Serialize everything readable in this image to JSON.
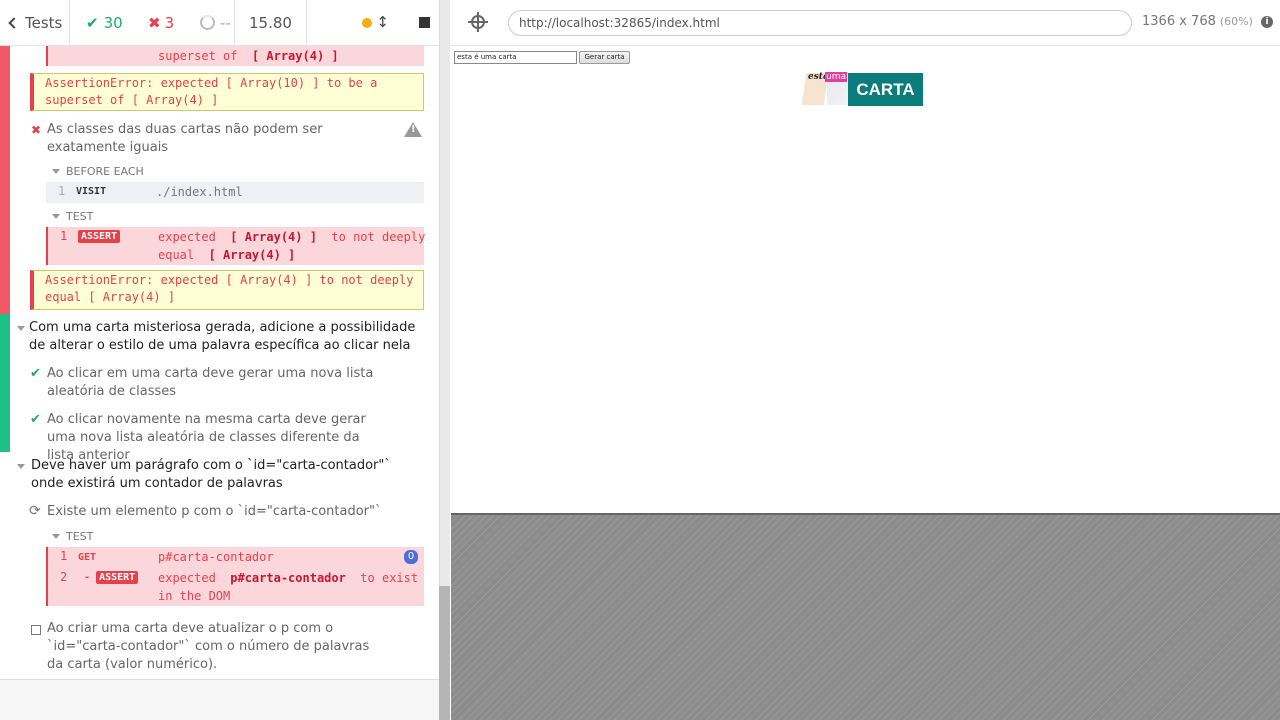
{
  "stats": {
    "tests_label": "Tests",
    "passed": "30",
    "failed": "3",
    "pending": "--",
    "duration": "15.80"
  },
  "runnable": {
    "top_fragment": {
      "prefix": "superset of",
      "bold": "[ Array(4) ]"
    },
    "error1": "AssertionError: expected [ Array(10) ] to be a superset of [ Array(4) ]",
    "failed_test": "As classes das duas cartas não podem ser exatamente iguais",
    "before_each_label": "BEFORE EACH",
    "visit_cmd": {
      "num": "1",
      "name": "VISIT",
      "msg": "./index.html"
    },
    "test_label": "TEST",
    "assert_cmd": {
      "num": "1",
      "name": "ASSERT",
      "msg_pre": "expected",
      "msg_bold1": "[ Array(4) ]",
      "msg_mid": "to not deeply equal",
      "msg_bold2": "[ Array(4) ]"
    },
    "error2": "AssertionError: expected [ Array(4) ] to not deeply equal [ Array(4) ]",
    "suite2_title": "Com uma carta misteriosa gerada, adicione a possibilidade de alterar o estilo de uma palavra específica ao clicar nela",
    "suite2_tests": [
      "Ao clicar em uma carta deve gerar uma nova lista aleatória de classes",
      "Ao clicar novamente na mesma carta deve gerar uma nova lista aleatória de classes diferente da lista anterior"
    ],
    "suite3_title": "Deve haver um parágrafo com o `id=\"carta-contador\"` onde existirá um contador de palavras",
    "running_test": "Existe um elemento p com o `id=\"carta-contador\"`",
    "test_label2": "TEST",
    "get_cmd": {
      "num": "1",
      "name": "GET",
      "msg": "p#carta-contador",
      "badge": "0"
    },
    "assert_cmd2": {
      "num": "2",
      "dash": "-",
      "name": "ASSERT",
      "msg_pre": "expected",
      "msg_bold": "p#carta-contador",
      "msg_post": "to exist in the DOM"
    },
    "pending_test": "Ao criar uma carta deve atualizar o p com o `id=\"carta-contador\"` com o número de palavras da carta (valor numérico)."
  },
  "aut": {
    "url": "http://localhost:32865/index.html",
    "viewport": "1366 x 768",
    "scale": "(60%)",
    "input_value": "esta é uma carta",
    "button_label": "Gerar carta",
    "words": [
      "esta",
      "uma",
      "CARTA"
    ]
  },
  "colors": {
    "pass": "#1fa971",
    "fail": "#e4414b",
    "card_carta_bg": "#0b7c7c",
    "card_uma_bg": "#e040a0"
  }
}
